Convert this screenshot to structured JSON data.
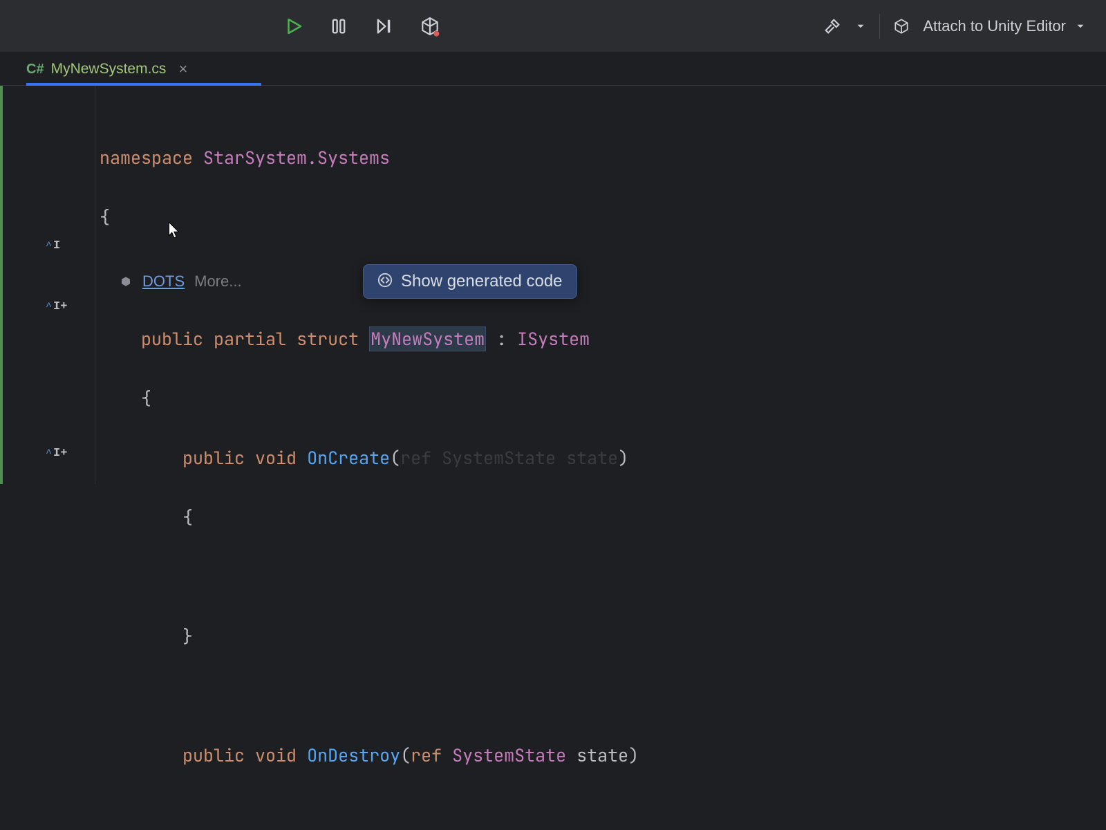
{
  "toolbar": {
    "attach_label": "Attach to Unity Editor"
  },
  "tab": {
    "lang": "C#",
    "filename": "MyNewSystem.cs"
  },
  "hints": {
    "dots_label": "DOTS",
    "more_label": "More..."
  },
  "popup": {
    "label": "Show generated code"
  },
  "code": {
    "kw_namespace": "namespace",
    "namespace_val": "StarSystem.Systems",
    "brace_open": "{",
    "brace_close": "}",
    "kw_public": "public",
    "kw_partial": "partial",
    "kw_struct": "struct",
    "struct_name": "MyNewSystem",
    "colon": " : ",
    "interface": "ISystem",
    "kw_void": "void",
    "fn_oncreate": "OnCreate",
    "fn_ondestroy": "OnDestroy",
    "sig_open": "(",
    "kw_ref": "ref",
    "param_type": "SystemState",
    "param_name": "state",
    "sig_close": ")"
  }
}
